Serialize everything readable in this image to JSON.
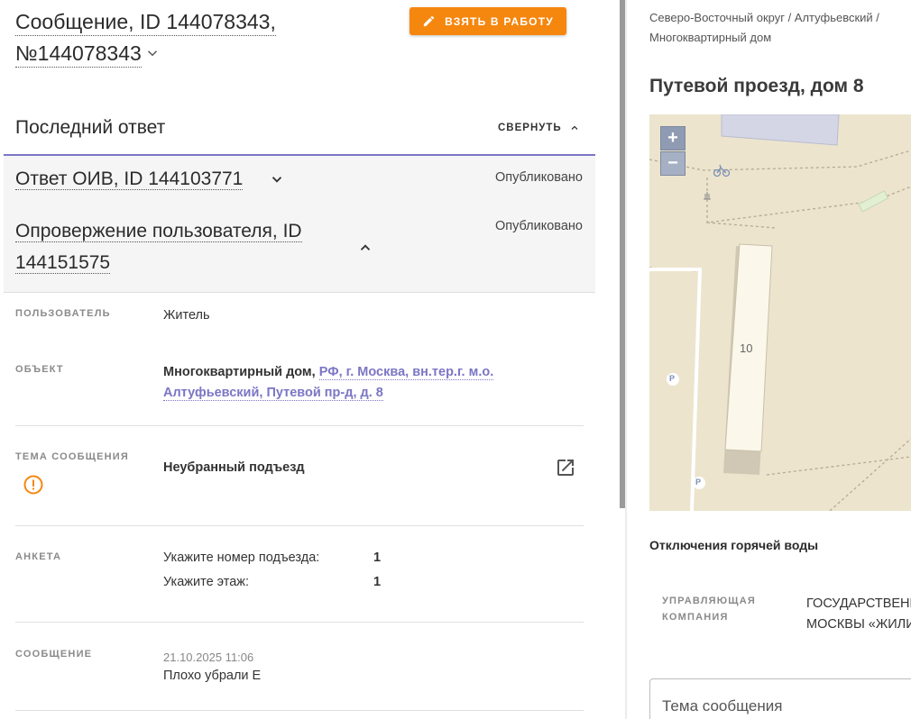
{
  "header": {
    "title_line1": "Сообщение, ID 144078343,",
    "title_line2": "№144078343",
    "take_button": "ВЗЯТЬ В РАБОТУ"
  },
  "last_answer": {
    "title": "Последний ответ",
    "collapse": "СВЕРНУТЬ",
    "answers": [
      {
        "title": "Ответ ОИВ, ID 144103771",
        "status": "Опубликовано"
      },
      {
        "title": "Опровержение пользователя, ID 144151575",
        "status": "Опубликовано"
      }
    ]
  },
  "details": {
    "user": {
      "label": "ПОЛЬЗОВАТЕЛЬ",
      "value": "Житель"
    },
    "object": {
      "label": "ОБЪЕКТ",
      "type": "Многоквартирный дом,",
      "address": "РФ, г. Москва, вн.тер.г. м.о. Алтуфьевский, Путевой пр-д, д. 8"
    },
    "topic": {
      "label": "ТЕМА СООБЩЕНИЯ",
      "value": "Неубранный подъезд"
    },
    "form": {
      "label": "АНКЕТА",
      "items": [
        {
          "q": "Укажите номер подъезда:",
          "a": "1"
        },
        {
          "q": "Укажите этаж:",
          "a": "1"
        }
      ]
    },
    "message": {
      "label": "СООБЩЕНИЕ",
      "date": "21.10.2025 11:06",
      "text": "Плохо убрали Е"
    }
  },
  "right_panel": {
    "breadcrumb_line1": "Северо-Восточный округ / Алтуфьевский /",
    "breadcrumb_line2": "Многоквартирный дом",
    "address": "Путевой проезд, дом 8",
    "map": {
      "zoom_in": "+",
      "zoom_out": "−",
      "building_number": "10",
      "parking": "P"
    },
    "hot_water": "Отключения горячей воды",
    "management_company_label": "УПРАВЛЯЮЩАЯ КОМПАНИЯ",
    "management_company_line1": "ГОСУДАРСТВЕННОЕ",
    "management_company_line2": "МОСКВЫ «ЖИЛИЩНИК",
    "topic_field_label": "Тема сообщения"
  },
  "colors": {
    "accent_orange": "#f5870f",
    "accent_purple": "#7b76c4"
  }
}
